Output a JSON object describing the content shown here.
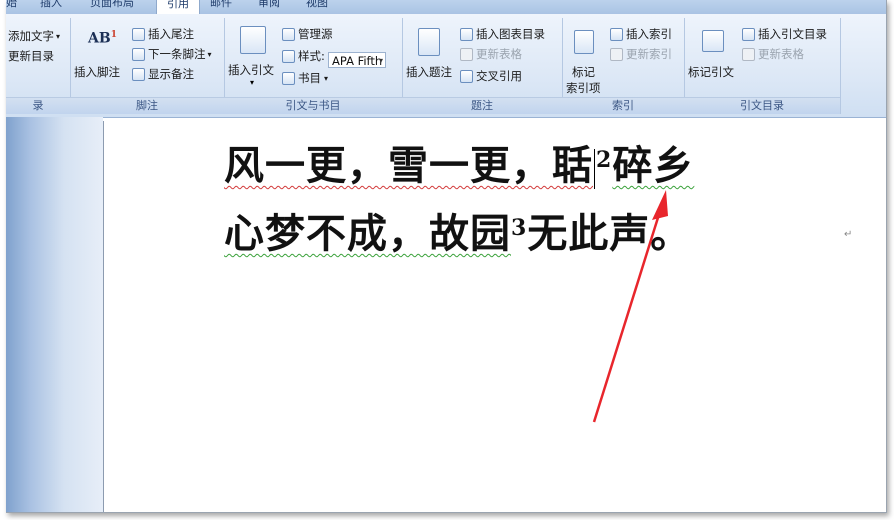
{
  "tabs": [
    "始",
    "插入",
    "页面布局",
    "引用",
    "邮件",
    "审阅",
    "视图"
  ],
  "active_tab_index": 3,
  "toc_group": {
    "items": [
      "添加文字",
      "更新目录"
    ],
    "label": "录"
  },
  "footnotes_group": {
    "big_button": "插入脚注",
    "big_icon_text": "AB",
    "big_icon_sup": "1",
    "items": [
      "插入尾注",
      "下一条脚注",
      "显示备注"
    ],
    "label": "脚注"
  },
  "citations_group": {
    "big_button": "插入引文",
    "manage_sources": "管理源",
    "style_label": "样式:",
    "style_value": "APA Fifth",
    "bibliography": "书目",
    "label": "引文与书目"
  },
  "captions_group": {
    "big_button": "插入题注",
    "insert_table_of_figures": "插入图表目录",
    "update_table": "更新表格",
    "cross_reference": "交叉引用",
    "label": "题注"
  },
  "index_group": {
    "big_button_line1": "标记",
    "big_button_line2": "索引项",
    "insert_index": "插入索引",
    "update_index": "更新索引",
    "label": "索引"
  },
  "authorities_group": {
    "big_button": "标记引文",
    "insert_table_of_authorities": "插入引文目录",
    "update_table": "更新表格",
    "label": "引文目录"
  },
  "document": {
    "line1_part1": "风一更，雪一更，聒",
    "line1_sup": "2",
    "line1_part2": "碎乡",
    "line2_part1": "心梦不成，故园",
    "line2_sup": "3",
    "line2_part2": "无此声。",
    "para_mark": "↵"
  },
  "colors": {
    "arrow": "#e8262c",
    "ribbon": "#dde8f6",
    "side_pane": "#a9c1e2"
  }
}
